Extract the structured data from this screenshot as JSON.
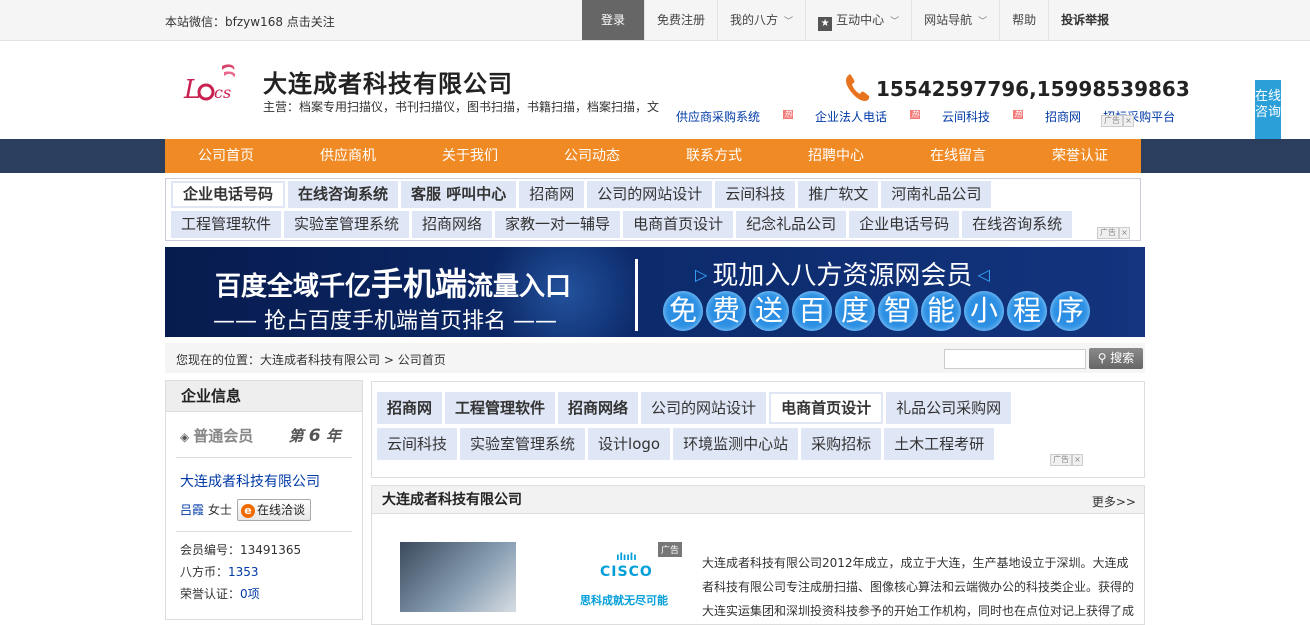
{
  "topbar": {
    "wechat": "本站微信：bfzyw168 点击关注",
    "nav": [
      {
        "label": "登录"
      },
      {
        "label": "免费注册"
      },
      {
        "label": "我的八方"
      },
      {
        "label": "互动中心"
      },
      {
        "label": "网站导航"
      },
      {
        "label": "帮助"
      },
      {
        "label": "投诉举报"
      }
    ]
  },
  "header": {
    "company_name": "大连成者科技有限公司",
    "main_business": "主营：档案专用扫描仪，书刊扫描仪，图书扫描，书籍扫描，档案扫描，文",
    "phone": "15542597796,15998539863",
    "links": [
      "供应商采购系统",
      "企业法人电话",
      "云间科技",
      "招商网",
      "招标采购平台"
    ],
    "ad_label": "广告",
    "ad_close": "×"
  },
  "consult": "在线咨询",
  "mainnav": [
    "公司首页",
    "供应商机",
    "关于我们",
    "公司动态",
    "联系方式",
    "招聘中心",
    "在线留言",
    "荣誉认证"
  ],
  "keywords_top": {
    "row1": [
      "企业电话号码",
      "在线咨询系统",
      "客服 呼叫中心",
      "招商网",
      "公司的网站设计",
      "云间科技",
      "推广软文",
      "河南礼品公司"
    ],
    "row2": [
      "工程管理软件",
      "实验室管理系统",
      "招商网络",
      "家教一对一辅导",
      "电商首页设计",
      "纪念礼品公司",
      "企业电话号码",
      "在线咨询系统"
    ]
  },
  "banner": {
    "line1a": "百度全域千亿",
    "line1b": "手机端",
    "line1c": "流量入口",
    "line2": "—— 抢占百度手机端首页排名 ——",
    "line3": "现加入八方资源网会员",
    "circles": [
      "免",
      "费",
      "送",
      "百",
      "度",
      "智",
      "能",
      "小",
      "程",
      "序"
    ]
  },
  "breadcrumb": {
    "prefix": "您现在的位置：",
    "path1": "大连成者科技有限公司",
    "sep": " > ",
    "path2": "公司首页",
    "search_button": "搜索"
  },
  "sidebar": {
    "title": "企业信息",
    "member_level": "普通会员",
    "year_prefix": "第",
    "years": "6",
    "year_suffix": "年",
    "company": "大连成者科技有限公司",
    "contact_name": "吕霞",
    "contact_title": "女士",
    "chat_label": "在线洽谈",
    "member_no_label": "会员编号：",
    "member_no": "13491365",
    "coins_label": "八方币：",
    "coins": "1353",
    "honor_label": "荣誉认证：",
    "honor": "0项"
  },
  "keywords_content": {
    "row1": [
      "招商网",
      "工程管理软件",
      "招商网络",
      "公司的网站设计",
      "电商首页设计",
      "礼品公司采购网"
    ],
    "row2": [
      "云间科技",
      "实验室管理系统",
      "设计logo",
      "环境监测中心站",
      "采购招标",
      "土木工程考研"
    ]
  },
  "section": {
    "title": "大连成者科技有限公司",
    "more": "更多>>",
    "ad_brand": "CISCO",
    "ad_slogan": "思科成就无尽可能",
    "ad_flag": "广告",
    "intro": "大连成者科技有限公司2012年成立，成立于大连，生产基地设立于深圳。大连成者科技有限公司专注成册扫描、图像核心算法和云端微办公的科技类企业。获得的大连实运集团和深圳投资科技参予的开始工作机构，同时也在点位对记上获得了成"
  },
  "colors": {
    "orange_nav": "#f08a24",
    "dark_nav": "#2c3e5e",
    "link_blue": "#003aa6",
    "consult_blue": "#2a9fd8"
  }
}
